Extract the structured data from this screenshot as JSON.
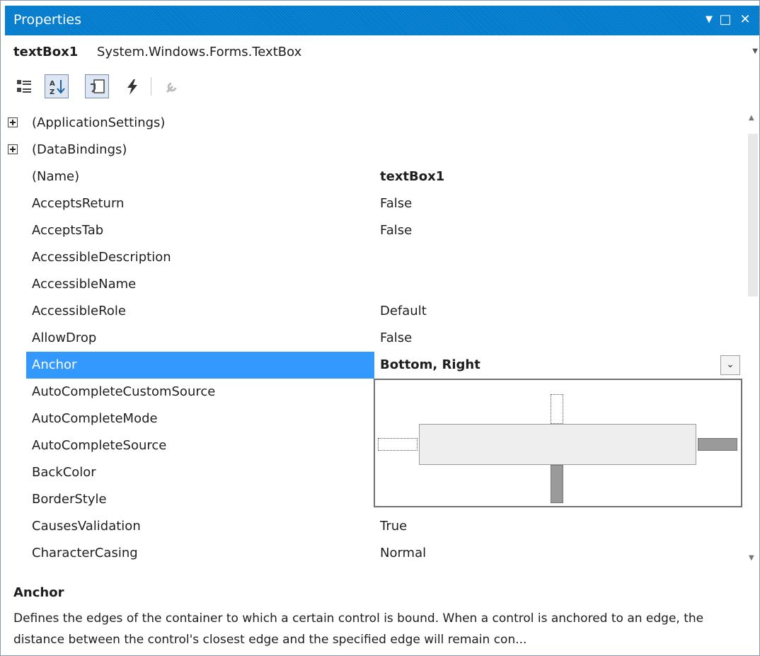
{
  "window": {
    "title": "Properties",
    "dropdown_glyph": "▼",
    "maximize_glyph": "□",
    "close_glyph": "✕"
  },
  "selector": {
    "object_name": "textBox1",
    "object_type": "System.Windows.Forms.TextBox",
    "arrow_glyph": "▼"
  },
  "toolbar": {
    "icons": [
      "categorized-icon",
      "alphabetical-icon",
      "properties-icon",
      "events-icon",
      "property-pages-icon"
    ],
    "active": [
      "alphabetical",
      "properties"
    ]
  },
  "grid": {
    "rows": [
      {
        "name": "(ApplicationSettings)",
        "value": "",
        "expandable": true
      },
      {
        "name": "(DataBindings)",
        "value": "",
        "expandable": true
      },
      {
        "name": "(Name)",
        "value": "textBox1",
        "bold": true
      },
      {
        "name": "AcceptsReturn",
        "value": "False"
      },
      {
        "name": "AcceptsTab",
        "value": "False"
      },
      {
        "name": "AccessibleDescription",
        "value": ""
      },
      {
        "name": "AccessibleName",
        "value": ""
      },
      {
        "name": "AccessibleRole",
        "value": "Default"
      },
      {
        "name": "AllowDrop",
        "value": "False"
      },
      {
        "name": "Anchor",
        "value": "Bottom, Right",
        "bold": true,
        "selected": true
      },
      {
        "name": "AutoCompleteCustomSource",
        "value": ""
      },
      {
        "name": "AutoCompleteMode",
        "value": ""
      },
      {
        "name": "AutoCompleteSource",
        "value": ""
      },
      {
        "name": "BackColor",
        "value": ""
      },
      {
        "name": "BorderStyle",
        "value": ""
      },
      {
        "name": "CausesValidation",
        "value": "True"
      },
      {
        "name": "CharacterCasing",
        "value": "Normal"
      }
    ],
    "dropdown_glyph": "⌄"
  },
  "anchor_editor": {
    "top": false,
    "left": false,
    "right": true,
    "bottom": true
  },
  "colors": {
    "titlebar": "#007acc",
    "selection": "#3399ff"
  },
  "description": {
    "title": "Anchor",
    "text": "Defines the edges of the container to which a certain control is bound. When a control is anchored to an edge, the distance between the control's closest edge and the specified edge will remain con..."
  }
}
